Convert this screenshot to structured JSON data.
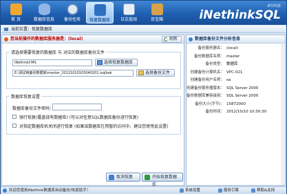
{
  "toolbar": {
    "items": [
      {
        "label": "首 页",
        "icon": "home-icon",
        "color": "#f0a830"
      },
      {
        "label": "数据库信息",
        "icon": "database-icon",
        "color": "#8fb6e6"
      },
      {
        "label": "备份任务",
        "icon": "clock-icon",
        "color": "#dfe9f5"
      },
      {
        "label": "恢复数据库",
        "icon": "restore-icon",
        "color": "#2f6fc0"
      },
      {
        "label": "日志查阅",
        "icon": "log-icon",
        "color": "#e8eef6"
      },
      {
        "label": "百宝箱",
        "icon": "toolbox-icon",
        "color": "#d8a24a"
      }
    ],
    "active_index": 3
  },
  "brand": {
    "sub": "卓尔科技",
    "name": "iNethinkSQL"
  },
  "breadcrumb": "当前位置：恢复数据库",
  "left": {
    "header": "您当前操作的数据库服务器是：(local)",
    "refresh_label": "刷新",
    "group1": {
      "legend": "请选择需要恢复的数据库 与 对应的数据库备份文件",
      "db_value": "iNethinkCMS",
      "db_button": "选择恢复数据库",
      "file_value": "E:\\测试用备份数据库\\master_20121010103040201.isqlbak",
      "file_button": "选择备份文件"
    },
    "group2": {
      "legend": "数据库恢复设置",
      "password_label": "数据库备份文件密码：",
      "password_value": "",
      "option1": "强行恢复(覆盖现有数据库) (可以对任意SQL数据库备份进行恢复)",
      "option2": "对指定数据库机关闭进行恢复 (如果该数据库在用暂的访问中，建议您使用此设置)"
    },
    "cancel_button": "取消恢复",
    "start_button": "开始恢复数据库"
  },
  "right": {
    "header": "数据库备份文件分析信息",
    "rows": [
      {
        "k": "备份服务器名：",
        "v": "(local)"
      },
      {
        "k": "备份数据库名称：",
        "v": "master"
      },
      {
        "k": "备份类型：",
        "v": "数据库"
      },
      {
        "k": "创建备份计算机名：",
        "v": "VPC-021"
      },
      {
        "k": "创建备份用户名称：",
        "v": "sa"
      },
      {
        "k": "创建备份服务器版本：",
        "v": "SQL Server 2000"
      },
      {
        "k": "备份数据库兼容级别：",
        "v": "SQL Server 2000"
      },
      {
        "k": "备份大小(字节)：",
        "v": "15872000"
      },
      {
        "k": "备份时间：",
        "v": "2012/10/10 10:30:30"
      }
    ]
  },
  "status": {
    "message": "欢迎您使用iNethink数据库自动备份/恢复助手！",
    "items": [
      "系统设置",
      "服务引擎",
      "帮助&支持"
    ]
  }
}
